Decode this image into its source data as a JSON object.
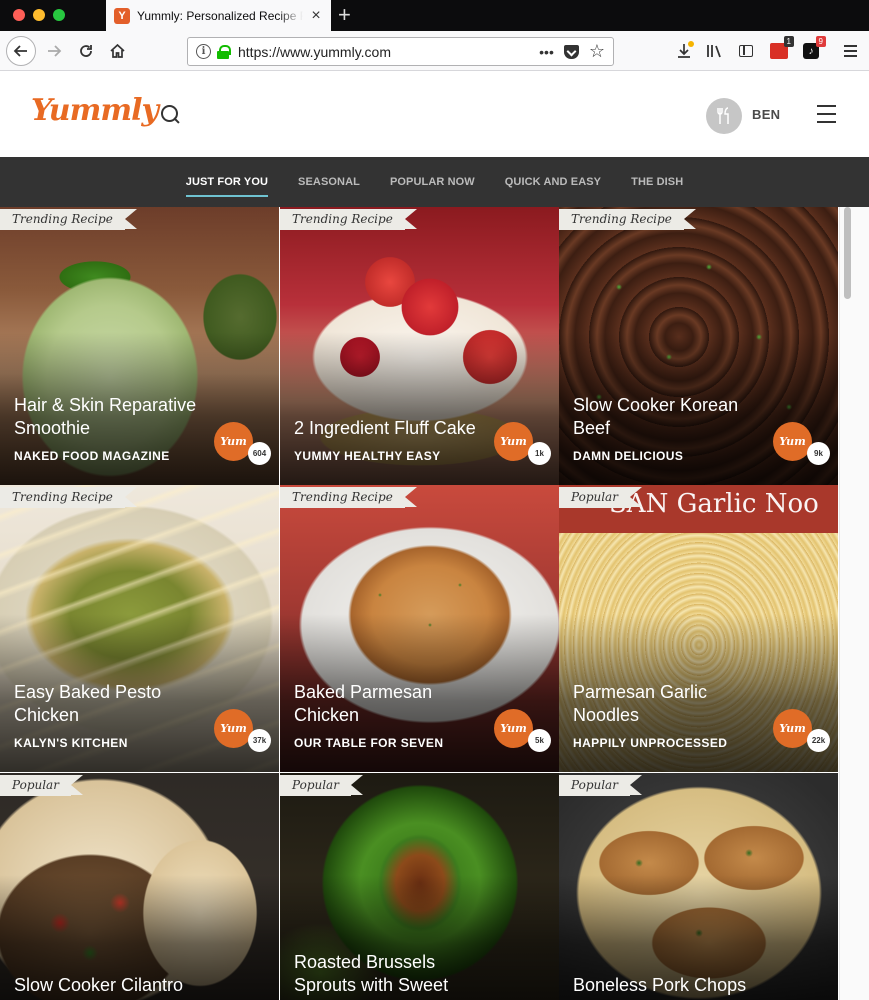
{
  "browser": {
    "tab_title": "Yummly: Personalized Recipe Recommendations",
    "tab_favicon": "Y",
    "url": "https://www.yummly.com",
    "new_tab_label": "+",
    "close_tab_label": "×",
    "extension_badges": [
      "1",
      "9"
    ]
  },
  "header": {
    "logo_text": "Yummly",
    "user_name": "BEN"
  },
  "categories": [
    {
      "label": "JUST FOR YOU",
      "active": true
    },
    {
      "label": "SEASONAL"
    },
    {
      "label": "POPULAR NOW"
    },
    {
      "label": "QUICK AND EASY"
    },
    {
      "label": "THE DISH"
    }
  ],
  "yum_label": "Yum",
  "cards": [
    {
      "badge": "Trending Recipe",
      "title": "Hair & Skin Reparative Smoothie",
      "source": "NAKED FOOD MAGAZINE",
      "count": "604"
    },
    {
      "badge": "Trending Recipe",
      "title": "2 Ingredient Fluff Cake",
      "source": "YUMMY HEALTHY EASY",
      "count": "1k"
    },
    {
      "badge": "Trending Recipe",
      "title": "Slow Cooker Korean Beef",
      "source": "DAMN DELICIOUS",
      "count": "9k"
    },
    {
      "badge": "Trending Recipe",
      "title": "Easy Baked Pesto Chicken",
      "source": "KALYN'S KITCHEN",
      "count": "37k"
    },
    {
      "badge": "Trending Recipe",
      "title": "Baked Parmesan Chicken",
      "source": "OUR TABLE FOR SEVEN",
      "count": "5k"
    },
    {
      "badge": "Popular",
      "title": "Parmesan Garlic Noodles",
      "source": "HAPPILY UNPROCESSED",
      "count": "22k",
      "overlay": "SAN  Garlic Noo"
    },
    {
      "badge": "Popular",
      "title": "Slow Cooker Cilantro",
      "source": "",
      "count": ""
    },
    {
      "badge": "Popular",
      "title": "Roasted Brussels Sprouts with Sweet",
      "source": "",
      "count": ""
    },
    {
      "badge": "Popular",
      "title": "Boneless Pork Chops",
      "source": "",
      "count": ""
    }
  ],
  "colors": {
    "accent": "#e06c27",
    "nav_bg": "#333333",
    "active_underline": "#6fc3d1"
  }
}
